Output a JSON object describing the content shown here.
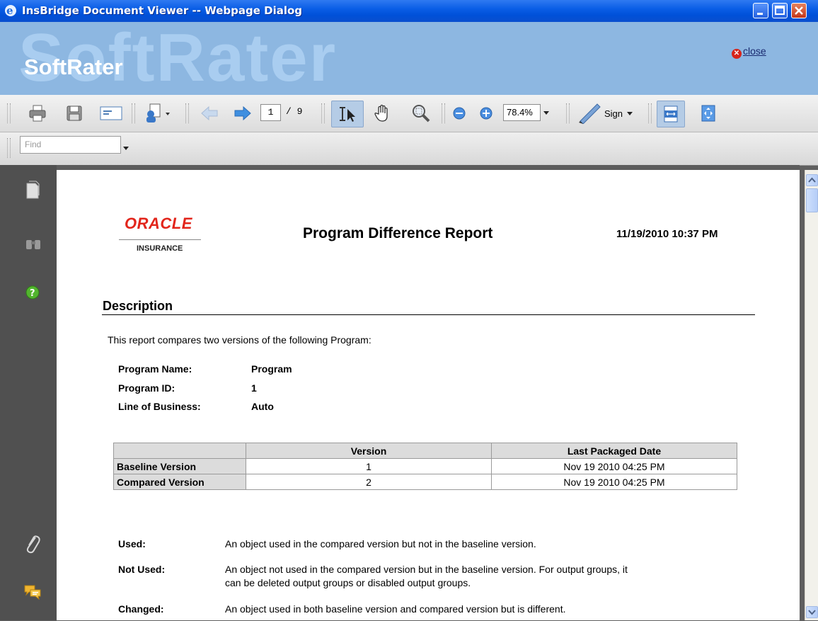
{
  "window": {
    "title": "InsBridge Document Viewer -- Webpage Dialog"
  },
  "banner": {
    "brand": "SoftRater",
    "ghost": "SoftRater",
    "close_label": "close"
  },
  "toolbar": {
    "page_current": "1",
    "page_total": "/ 9",
    "zoom": "78.4%",
    "sign_label": "Sign"
  },
  "find": {
    "placeholder": "Find"
  },
  "report": {
    "logo_brand": "ORACLE",
    "logo_sub": "INSURANCE",
    "title": "Program Difference Report",
    "datetime": "11/19/2010 10:37 PM",
    "section_title": "Description",
    "intro": "This report compares two versions of the following Program:",
    "fields": [
      {
        "key": "Program Name:",
        "value": "Program"
      },
      {
        "key": "Program ID:",
        "value": "1"
      },
      {
        "key": "Line of Business:",
        "value": "Auto"
      }
    ],
    "table": {
      "headers": [
        "",
        "Version",
        "Last Packaged Date"
      ],
      "rows": [
        {
          "label": "Baseline Version",
          "version": "1",
          "date": "Nov 19 2010 04:25 PM"
        },
        {
          "label": "Compared Version",
          "version": "2",
          "date": "Nov 19 2010 04:25 PM"
        }
      ]
    },
    "legend": [
      {
        "key": "Used:",
        "text": "An object used in the compared version but not in the baseline version."
      },
      {
        "key": "Not Used:",
        "text": "An object not used in the compared version but in the baseline version. For output groups, it",
        "text2": "can be deleted output groups or disabled output groups."
      },
      {
        "key": "Changed:",
        "text": "An object used in both baseline version and compared version but is different."
      }
    ]
  },
  "colors": {
    "titlebar": "#0a5ee6",
    "banner": "#8db7e1",
    "sidebar": "#505050",
    "oracle_red": "#e2251b"
  }
}
